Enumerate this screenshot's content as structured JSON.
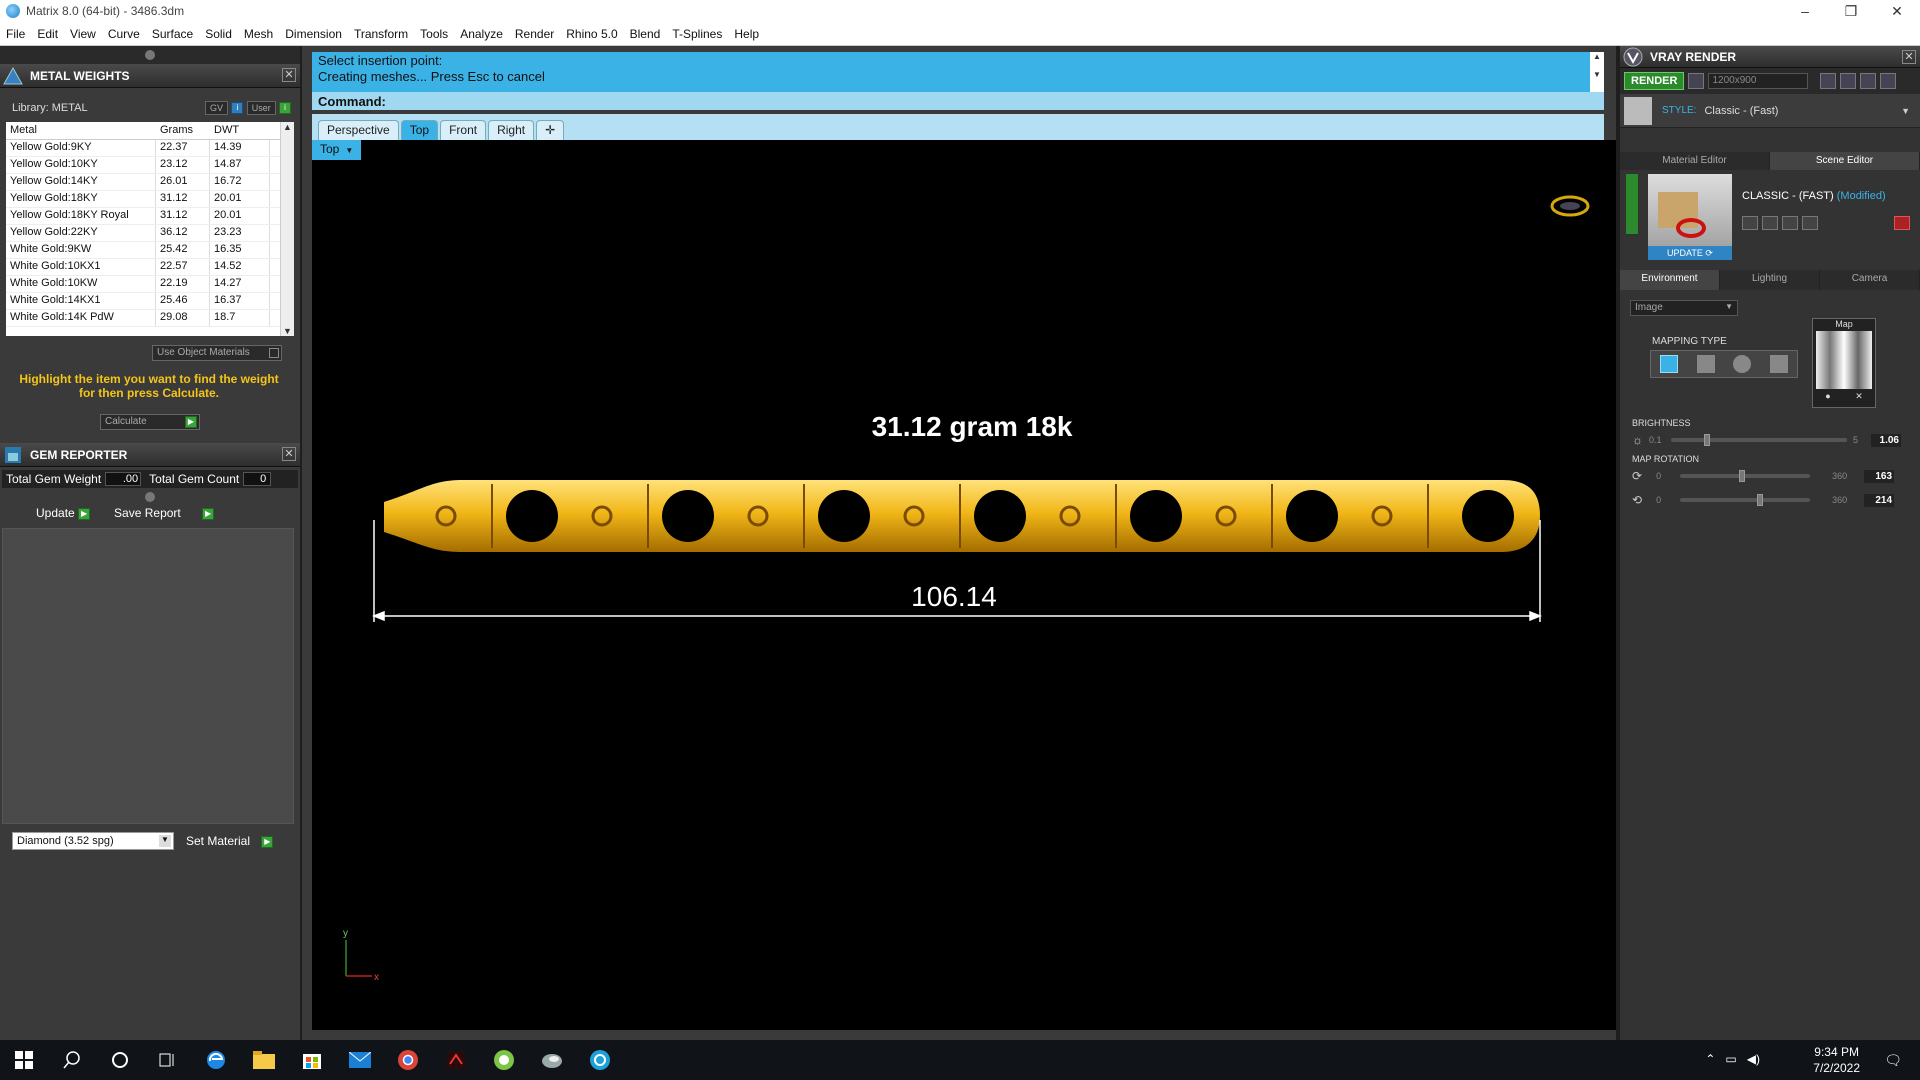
{
  "window": {
    "title": "Matrix 8.0 (64-bit) - 3486.3dm"
  },
  "menu": [
    "File",
    "Edit",
    "View",
    "Curve",
    "Surface",
    "Solid",
    "Mesh",
    "Dimension",
    "Transform",
    "Tools",
    "Analyze",
    "Render",
    "Rhino 5.0",
    "Blend",
    "T-Splines",
    "Help"
  ],
  "metal_weights": {
    "title": "METAL WEIGHTS",
    "library_label": "Library: METAL",
    "gv_label": "GV",
    "user_label": "User",
    "columns": [
      "Metal",
      "Grams",
      "DWT"
    ],
    "rows": [
      [
        "Yellow Gold:9KY",
        "22.37",
        "14.39"
      ],
      [
        "Yellow Gold:10KY",
        "23.12",
        "14.87"
      ],
      [
        "Yellow Gold:14KY",
        "26.01",
        "16.72"
      ],
      [
        "Yellow Gold:18KY",
        "31.12",
        "20.01"
      ],
      [
        "Yellow Gold:18KY Royal",
        "31.12",
        "20.01"
      ],
      [
        "Yellow Gold:22KY",
        "36.12",
        "23.23"
      ],
      [
        "White Gold:9KW",
        "25.42",
        "16.35"
      ],
      [
        "White Gold:10KX1",
        "22.57",
        "14.52"
      ],
      [
        "White Gold:10KW",
        "22.19",
        "14.27"
      ],
      [
        "White Gold:14KX1",
        "25.46",
        "16.37"
      ],
      [
        "White Gold:14K PdW",
        "29.08",
        "18.7"
      ]
    ],
    "use_object_materials": "Use Object Materials",
    "hint": "Highlight the item you want to find the weight for then press Calculate.",
    "calculate_label": "Calculate"
  },
  "gem_reporter": {
    "title": "GEM REPORTER",
    "total_weight_label": "Total Gem Weight",
    "total_weight_value": ".00",
    "total_count_label": "Total Gem Count",
    "total_count_value": "0",
    "update_label": "Update",
    "save_report_label": "Save Report",
    "material_select": "Diamond    (3.52 spg)",
    "set_material_label": "Set Material"
  },
  "command": {
    "line1": "Select insertion point:",
    "line2": "Creating meshes... Press Esc to cancel",
    "prompt": "Command:"
  },
  "viewport_tabs": [
    "Perspective",
    "Top",
    "Front",
    "Right"
  ],
  "active_tab": "Top",
  "viewport_label": "Top",
  "annotation": "31.12 gram 18k",
  "dimension": "106.14",
  "axis": {
    "y": "y",
    "x": "x"
  },
  "vray": {
    "title": "VRAY RENDER",
    "render_label": "RENDER",
    "resolution": "1200x900",
    "style_label": "STYLE:",
    "style_value": "Classic - (Fast)",
    "tabs": [
      "Material Editor",
      "Scene Editor"
    ],
    "scene_name": "CLASSIC - (FAST)",
    "scene_modified": "(Modified)",
    "update_label": "UPDATE",
    "env_tabs": [
      "Environment",
      "Lighting",
      "Camera"
    ],
    "env_type": "Image",
    "map_label": "Map",
    "mapping_type_label": "MAPPING TYPE",
    "brightness_label": "BRIGHTNESS",
    "brightness_min": "0.1",
    "brightness_max": "5",
    "brightness_value": "1.06",
    "brightness_level": 0.19,
    "map_rotation_label": "MAP ROTATION",
    "rot1_min": "0",
    "rot1_max": "360",
    "rot1_value": "163",
    "rot1_level": 0.45,
    "rot2_min": "0",
    "rot2_max": "360",
    "rot2_value": "214",
    "rot2_level": 0.59
  },
  "taskbar": {
    "time": "9:34 PM",
    "date": "7/2/2022"
  },
  "colors": {
    "accent": "#3ab2e6",
    "gold": "#f2b718",
    "hint": "#f5c518"
  }
}
